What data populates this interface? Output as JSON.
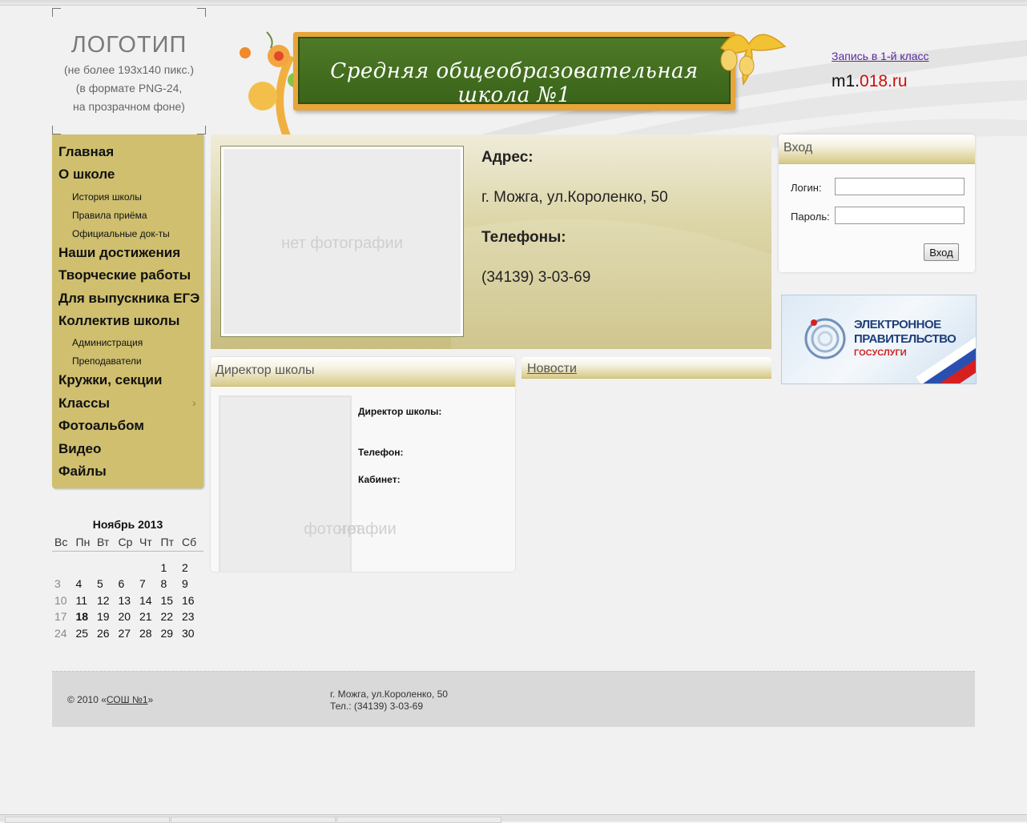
{
  "logo": {
    "title": "ЛОГОТИП",
    "line1": "(не более 193x140 пикс.)",
    "line2": "(в формате PNG-24,",
    "line3": "на прозрачном фоне)"
  },
  "banner": {
    "title": "Средняя общеобразовательная школа №1"
  },
  "header_links": {
    "enroll": "Запись в 1-й класс",
    "domain_prefix": "m1.",
    "domain_suffix": "018.ru"
  },
  "menu": {
    "items": [
      {
        "label": "Главная",
        "type": "main"
      },
      {
        "label": "О школе",
        "type": "main"
      },
      {
        "label": "История школы",
        "type": "sub"
      },
      {
        "label": "Правила приёма",
        "type": "sub"
      },
      {
        "label": "Официальные док-ты",
        "type": "sub"
      },
      {
        "label": "Наши достижения",
        "type": "main"
      },
      {
        "label": "Творческие работы",
        "type": "main"
      },
      {
        "label": "Для выпускника ЕГЭ",
        "type": "main"
      },
      {
        "label": "Коллектив школы",
        "type": "main"
      },
      {
        "label": "Администрация",
        "type": "sub"
      },
      {
        "label": "Преподаватели",
        "type": "sub"
      },
      {
        "label": "Кружки, секции",
        "type": "main"
      },
      {
        "label": "Классы",
        "type": "main",
        "arrow": "›"
      },
      {
        "label": "Фотоальбом",
        "type": "main"
      },
      {
        "label": "Видео",
        "type": "main"
      },
      {
        "label": "Файлы",
        "type": "main"
      }
    ]
  },
  "calendar": {
    "title": "Ноябрь 2013",
    "weekdays": [
      "Вс",
      "Пн",
      "Вт",
      "Ср",
      "Чт",
      "Пт",
      "Сб"
    ],
    "weeks": [
      [
        "",
        "",
        "",
        "",
        "",
        "1",
        "2"
      ],
      [
        "3",
        "4",
        "5",
        "6",
        "7",
        "8",
        "9"
      ],
      [
        "10",
        "11",
        "12",
        "13",
        "14",
        "15",
        "16"
      ],
      [
        "17",
        "18",
        "19",
        "20",
        "21",
        "22",
        "23"
      ],
      [
        "24",
        "25",
        "26",
        "27",
        "28",
        "29",
        "30"
      ]
    ],
    "today": "18"
  },
  "info": {
    "photo_placeholder": "нет фотографии",
    "address_label": "Адрес:",
    "address_value": "г. Можга, ул.Короленко, 50",
    "phones_label": "Телефоны:",
    "phones_value": "(34139) 3-03-69"
  },
  "director": {
    "panel_title": "Директор школы",
    "photo_line1": "нет",
    "photo_line2": "фотографии",
    "name_label": "Директор школы:",
    "phone_label": "Телефон:",
    "office_label": "Кабинет:"
  },
  "news": {
    "title": "Новости"
  },
  "login": {
    "panel_title": "Вход",
    "login_label": "Логин:",
    "password_label": "Пароль:",
    "login_value": "",
    "password_value": "",
    "submit": "Вход"
  },
  "gosuslugi": {
    "line1": "ЭЛЕКТРОННОЕ",
    "line2": "ПРАВИТЕЛЬСТВО",
    "line3": "ГОСУСЛУГИ"
  },
  "footer": {
    "copy_prefix": "© 2010 «",
    "copy_link": "СОШ №1",
    "copy_suffix": "»",
    "address": "г. Можга, ул.Короленко, 50",
    "phone": "Тел.: (34139) 3-03-69"
  }
}
